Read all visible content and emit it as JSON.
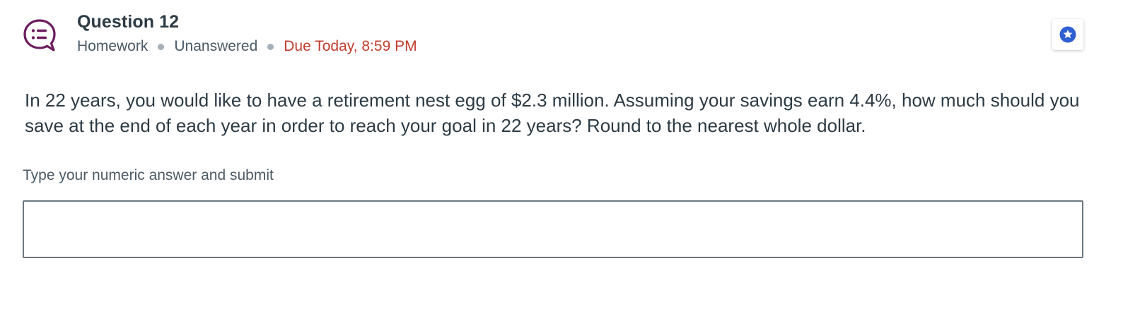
{
  "question": {
    "title": "Question 12",
    "type": "Homework",
    "status": "Unanswered",
    "due": "Due Today, 8:59 PM",
    "icon": "question-list-icon",
    "text": "In 22 years, you would like to have a retirement nest egg of $2.3 million. Assuming your savings earn 4.4%, how much should you save at the end of each year in order to reach your goal in 22 years? Round to the nearest whole dollar."
  },
  "answer": {
    "label": "Type your numeric answer and submit",
    "value": ""
  },
  "bookmark": {
    "icon": "star-icon"
  },
  "colors": {
    "icon_purple": "#6b1d5e",
    "due_red": "#c23c2d",
    "bookmark_blue": "#2f5fd0",
    "text": "#2d3b45"
  }
}
